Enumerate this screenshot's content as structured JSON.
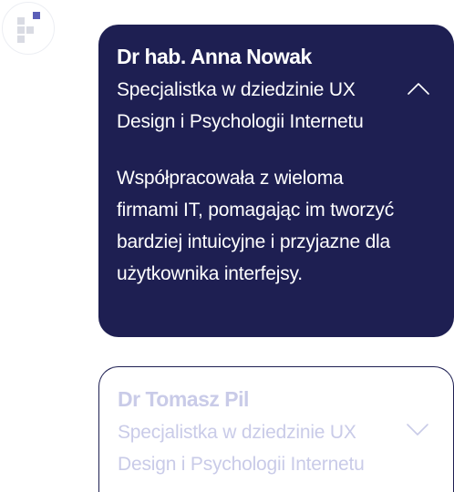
{
  "colors": {
    "card_open_bg": "#1e1f52",
    "card_closed_border": "#1e1f52",
    "closed_text": "#c9cbe8",
    "logo_accent": "#5b5fb8",
    "logo_gray": "#d9dbe3"
  },
  "logo": {
    "icon": "grid-squares-logo-icon"
  },
  "accordion": {
    "items": [
      {
        "name": "Dr hab. Anna Nowak",
        "role": "Specjalistka w dziedzinie UX Design i Psychologii Internetu",
        "bio": "Współpracowała z wieloma firmami IT, pomagając im tworzyć bardziej intuicyjne i przyjazne dla użytkownika interfejsy.",
        "expanded": true,
        "toggle_icon": "chevron-up-icon"
      },
      {
        "name": "Dr Tomasz Pil",
        "role": "Specjalistka w dziedzinie UX Design i Psychologii Internetu",
        "expanded": false,
        "toggle_icon": "chevron-down-icon"
      }
    ]
  }
}
